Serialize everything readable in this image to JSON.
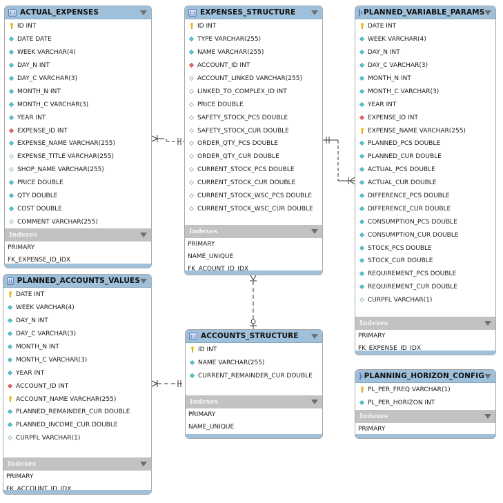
{
  "indexes_label": "Indexes",
  "tables": {
    "actual_expenses": {
      "name": "ACTUAL_EXPENSES",
      "columns": [
        {
          "icon": "key",
          "text": "ID INT"
        },
        {
          "icon": "nn",
          "text": "DATE DATE"
        },
        {
          "icon": "nn",
          "text": "WEEK VARCHAR(4)"
        },
        {
          "icon": "nn",
          "text": "DAY_N INT"
        },
        {
          "icon": "nn",
          "text": "DAY_C VARCHAR(3)"
        },
        {
          "icon": "nn",
          "text": "MONTH_N INT"
        },
        {
          "icon": "nn",
          "text": "MONTH_C VARCHAR(3)"
        },
        {
          "icon": "nn",
          "text": "YEAR INT"
        },
        {
          "icon": "fk",
          "text": "EXPENSE_ID INT"
        },
        {
          "icon": "nn",
          "text": "EXPENSE_NAME VARCHAR(255)"
        },
        {
          "icon": "nul",
          "text": "EXPENSE_TITLE VARCHAR(255)"
        },
        {
          "icon": "nul",
          "text": "SHOP_NAME VARCHAR(255)"
        },
        {
          "icon": "nn",
          "text": "PRICE DOUBLE"
        },
        {
          "icon": "nn",
          "text": "QTY DOUBLE"
        },
        {
          "icon": "nn",
          "text": "COST DOUBLE"
        },
        {
          "icon": "nul",
          "text": "COMMENT VARCHAR(255)"
        }
      ],
      "indexes": [
        "PRIMARY",
        "FK_EXPENSE_ID_IDX"
      ]
    },
    "expenses_structure": {
      "name": "EXPENSES_STRUCTURE",
      "columns": [
        {
          "icon": "key",
          "text": "ID INT"
        },
        {
          "icon": "nn",
          "text": "TYPE VARCHAR(255)"
        },
        {
          "icon": "nn",
          "text": "NAME VARCHAR(255)"
        },
        {
          "icon": "fk",
          "text": "ACCOUNT_ID INT"
        },
        {
          "icon": "nul",
          "text": "ACCOUNT_LINKED VARCHAR(255)"
        },
        {
          "icon": "nul",
          "text": "LINKED_TO_COMPLEX_ID INT"
        },
        {
          "icon": "nul",
          "text": "PRICE DOUBLE"
        },
        {
          "icon": "nul",
          "text": "SAFETY_STOCK_PCS DOUBLE"
        },
        {
          "icon": "nul",
          "text": "SAFETY_STOCK_CUR DOUBLE"
        },
        {
          "icon": "nul",
          "text": "ORDER_QTY_PCS DOUBLE"
        },
        {
          "icon": "nul",
          "text": "ORDER_QTY_CUR DOUBLE"
        },
        {
          "icon": "nul",
          "text": "CURRENT_STOCK_PCS DOUBLE"
        },
        {
          "icon": "nul",
          "text": "CURRENT_STOCK_CUR DOUBLE"
        },
        {
          "icon": "nul",
          "text": "CURRENT_STOCK_WSC_PCS DOUBLE"
        },
        {
          "icon": "nul",
          "text": "CURRENT_STOCK_WSC_CUR DOUBLE"
        }
      ],
      "indexes": [
        "PRIMARY",
        "NAME_UNIQUE",
        "FK_ACOUNT_ID_IDX"
      ]
    },
    "planned_variable_params": {
      "name": "PLANNED_VARIABLE_PARAMS",
      "columns": [
        {
          "icon": "key",
          "text": "DATE INT"
        },
        {
          "icon": "nn",
          "text": "WEEK VARCHAR(4)"
        },
        {
          "icon": "nn",
          "text": "DAY_N INT"
        },
        {
          "icon": "nn",
          "text": "DAY_C VARCHAR(3)"
        },
        {
          "icon": "nn",
          "text": "MONTH_N INT"
        },
        {
          "icon": "nn",
          "text": "MONTH_C VARCHAR(3)"
        },
        {
          "icon": "nn",
          "text": "YEAR INT"
        },
        {
          "icon": "fk",
          "text": "EXPENSE_ID INT"
        },
        {
          "icon": "key",
          "text": "EXPENSE_NAME VARCHAR(255)"
        },
        {
          "icon": "nn",
          "text": "PLANNED_PCS DOUBLE"
        },
        {
          "icon": "nn",
          "text": "PLANNED_CUR DOUBLE"
        },
        {
          "icon": "nn",
          "text": "ACTUAL_PCS DOUBLE"
        },
        {
          "icon": "nn",
          "text": "ACTUAL_CUR DOUBLE"
        },
        {
          "icon": "nn",
          "text": "DIFFERENCE_PCS DOUBLE"
        },
        {
          "icon": "nn",
          "text": "DIFFERENCE_CUR DOUBLE"
        },
        {
          "icon": "nn",
          "text": "CONSUMPTION_PCS DOUBLE"
        },
        {
          "icon": "nn",
          "text": "CONSUMPTION_CUR DOUBLE"
        },
        {
          "icon": "nn",
          "text": "STOCK_PCS DOUBLE"
        },
        {
          "icon": "nn",
          "text": "STOCK_CUR DOUBLE"
        },
        {
          "icon": "nn",
          "text": "REQUIREMENT_PCS DOUBLE"
        },
        {
          "icon": "nn",
          "text": "REQUIREMENT_CUR DOUBLE"
        },
        {
          "icon": "nul",
          "text": "CURPFL VARCHAR(1)"
        }
      ],
      "indexes": [
        "PRIMARY",
        "FK_EXPENSE_ID_IDX"
      ]
    },
    "planned_accounts_values": {
      "name": "PLANNED_ACCOUNTS_VALUES",
      "columns": [
        {
          "icon": "key",
          "text": "DATE INT"
        },
        {
          "icon": "nn",
          "text": "WEEK VARCHAR(4)"
        },
        {
          "icon": "nn",
          "text": "DAY_N INT"
        },
        {
          "icon": "nn",
          "text": "DAY_C VARCHAR(3)"
        },
        {
          "icon": "nn",
          "text": "MONTH_N INT"
        },
        {
          "icon": "nn",
          "text": "MONTH_C VARCHAR(3)"
        },
        {
          "icon": "nn",
          "text": "YEAR INT"
        },
        {
          "icon": "fk",
          "text": "ACCOUNT_ID INT"
        },
        {
          "icon": "key",
          "text": "ACCOUNT_NAME VARCHAR(255)"
        },
        {
          "icon": "nn",
          "text": "PLANNED_REMAINDER_CUR DOUBLE"
        },
        {
          "icon": "nn",
          "text": "PLANNED_INCOME_CUR DOUBLE"
        },
        {
          "icon": "nul",
          "text": "CURPFL VARCHAR(1)"
        }
      ],
      "indexes": [
        "PRIMARY",
        "FK_ACCOUNT_ID_IDX"
      ]
    },
    "accounts_structure": {
      "name": "ACCOUNTS_STRUCTURE",
      "columns": [
        {
          "icon": "key",
          "text": "ID INT"
        },
        {
          "icon": "nn",
          "text": "NAME VARCHAR(255)"
        },
        {
          "icon": "nn",
          "text": "CURRENT_REMAINDER_CUR DOUBLE"
        }
      ],
      "indexes": [
        "PRIMARY",
        "NAME_UNIQUE"
      ]
    },
    "planning_horizon_config": {
      "name": "PLANNING_HORIZON_CONFIG",
      "columns": [
        {
          "icon": "key",
          "text": "PL_PER_FREQ VARCHAR(1)"
        },
        {
          "icon": "nn",
          "text": "PL_PER_HORIZON INT"
        }
      ],
      "indexes": [
        "PRIMARY"
      ]
    }
  },
  "relationships": [
    {
      "from": "actual_expenses",
      "to": "expenses_structure",
      "type": "many-to-one"
    },
    {
      "from": "planned_variable_params",
      "to": "expenses_structure",
      "type": "many-to-one"
    },
    {
      "from": "expenses_structure",
      "to": "accounts_structure",
      "type": "many-to-zero-or-one"
    },
    {
      "from": "planned_accounts_values",
      "to": "accounts_structure",
      "type": "many-to-one"
    }
  ]
}
